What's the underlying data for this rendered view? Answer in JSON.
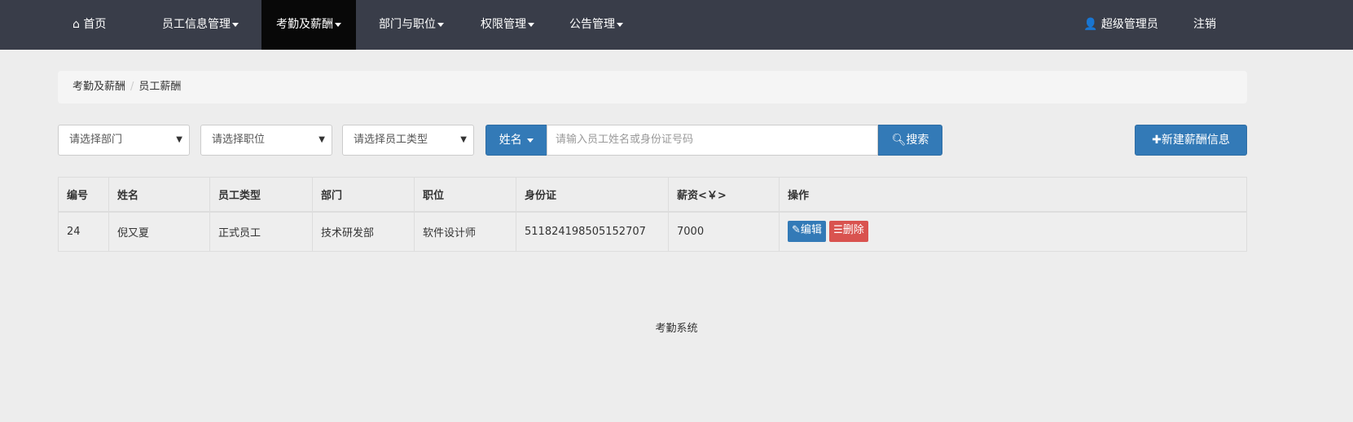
{
  "nav": {
    "brand": "首页",
    "items": [
      {
        "label": "员工信息管理"
      },
      {
        "label": "考勤及薪酬"
      },
      {
        "label": "部门与职位"
      },
      {
        "label": "权限管理"
      },
      {
        "label": "公告管理"
      }
    ],
    "user": "超级管理员",
    "logout": "注销"
  },
  "breadcrumb": [
    "考勤及薪酬",
    "员工薪酬"
  ],
  "filters": {
    "department": "请选择部门",
    "position": "请选择职位",
    "type": "请选择员工类型",
    "search_field": "姓名",
    "search_placeholder": "请输入员工姓名或身份证号码",
    "search_button": "搜索",
    "new_button": "新建薪酬信息"
  },
  "table": {
    "headers": [
      "编号",
      "姓名",
      "员工类型",
      "部门",
      "职位",
      "身份证",
      "薪资<￥>",
      "操作"
    ],
    "rows": [
      {
        "cells": [
          "24",
          "倪又夏",
          "正式员工",
          "技术研发部",
          "软件设计师",
          "511824198505152707",
          "7000"
        ],
        "edit": "编辑",
        "delete": "删除"
      }
    ]
  },
  "footer": "考勤系统"
}
